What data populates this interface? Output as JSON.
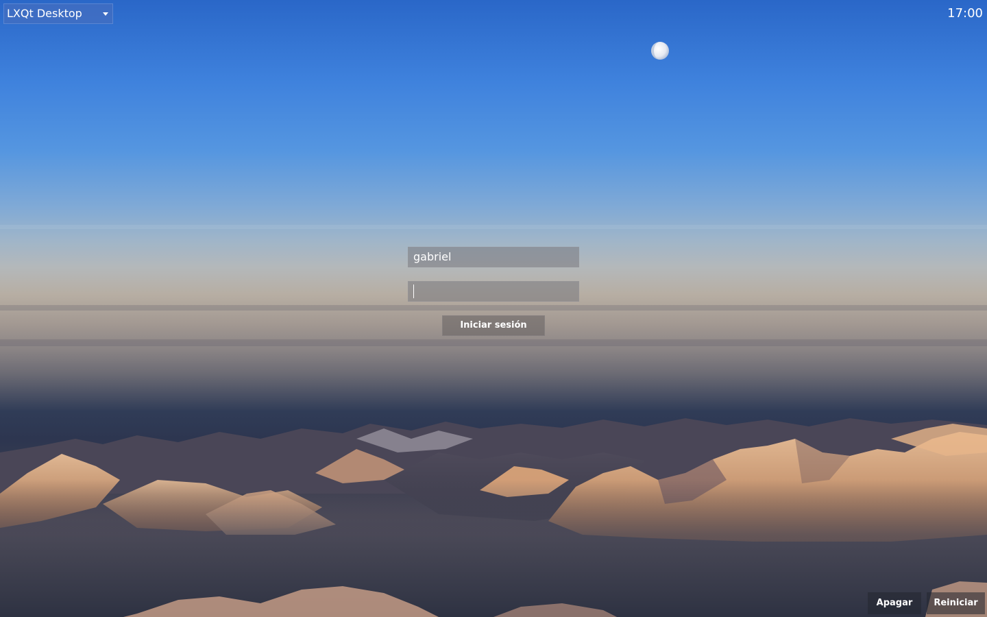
{
  "session": {
    "selected": "LXQt Desktop",
    "dropdown_icon": "caret-down-icon"
  },
  "clock": {
    "time": "17:00"
  },
  "login": {
    "username_value": "gabriel",
    "password_value": "",
    "submit_label": "Iniciar sesión"
  },
  "power": {
    "shutdown_label": "Apagar",
    "reboot_label": "Reiniciar"
  },
  "wallpaper": {
    "subject": "moon over sunlit snowy mountains above clouds",
    "sky_color": "#3f82dd",
    "horizon_color": "#b7aea3",
    "mountain_light_color": "#e0a77a"
  }
}
